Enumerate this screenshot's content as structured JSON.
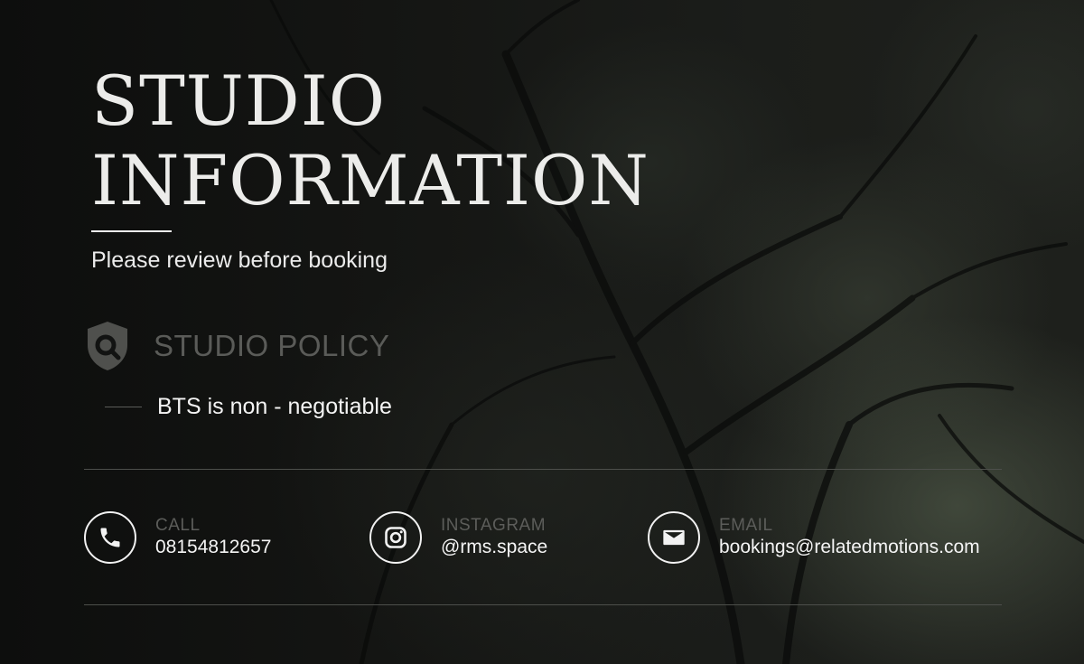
{
  "header": {
    "title_line1": "STUDIO",
    "title_line2": "INFORMATION",
    "subtitle": "Please review before booking"
  },
  "policy": {
    "title": "STUDIO POLICY",
    "icon": "shield-search-icon",
    "items": [
      "BTS is non - negotiable"
    ]
  },
  "contacts": [
    {
      "label": "CALL",
      "value": "08154812657",
      "icon": "phone-icon"
    },
    {
      "label": "INSTAGRAM",
      "value": "@rms.space",
      "icon": "instagram-icon"
    },
    {
      "label": "EMAIL",
      "value": "bookings@relatedmotions.com",
      "icon": "mail-icon"
    }
  ],
  "colors": {
    "background": "#101110",
    "title": "#ececea",
    "muted": "#5a5b58",
    "text": "#f4f4f4"
  }
}
